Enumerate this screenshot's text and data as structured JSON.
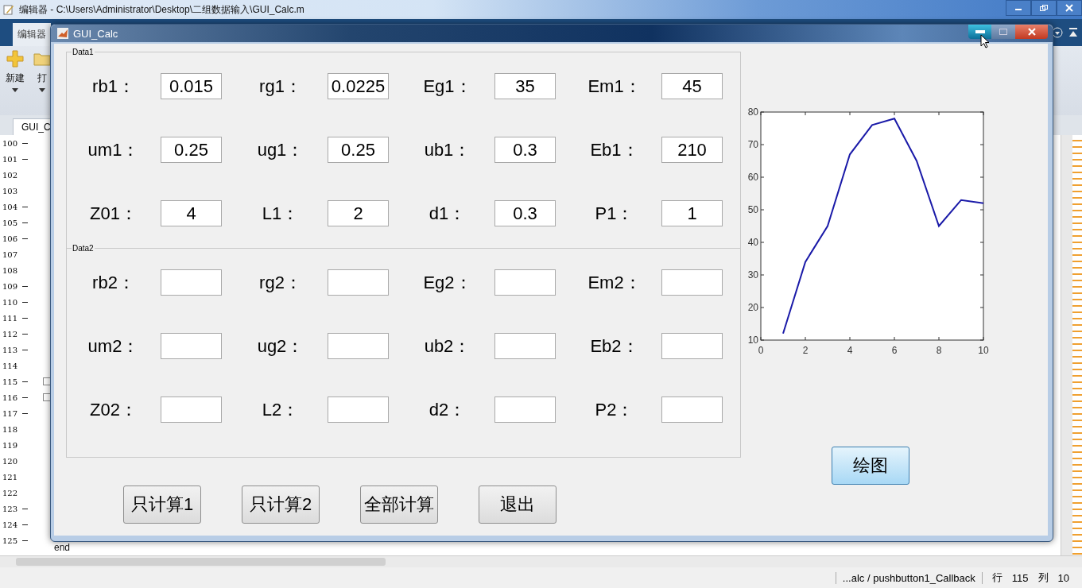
{
  "editor": {
    "title": "编辑器 - C:\\Users\\Administrator\\Desktop\\二组数据输入\\GUI_Calc.m",
    "ribbon_tab": "编辑器",
    "tools": [
      {
        "kind": "new",
        "label": "新建"
      },
      {
        "kind": "open",
        "label": "打"
      }
    ],
    "file_tab": "GUI_C",
    "lines": [
      {
        "number": "100",
        "marker": true,
        "fold": false
      },
      {
        "number": "101",
        "marker": true,
        "fold": false
      },
      {
        "number": "102",
        "marker": false,
        "fold": false
      },
      {
        "number": "103",
        "marker": false,
        "fold": false
      },
      {
        "number": "104",
        "marker": true,
        "fold": false
      },
      {
        "number": "105",
        "marker": true,
        "fold": false
      },
      {
        "number": "106",
        "marker": true,
        "fold": false
      },
      {
        "number": "107",
        "marker": false,
        "fold": false
      },
      {
        "number": "108",
        "marker": false,
        "fold": false
      },
      {
        "number": "109",
        "marker": true,
        "fold": false
      },
      {
        "number": "110",
        "marker": true,
        "fold": false
      },
      {
        "number": "111",
        "marker": true,
        "fold": false
      },
      {
        "number": "112",
        "marker": true,
        "fold": false
      },
      {
        "number": "113",
        "marker": true,
        "fold": false
      },
      {
        "number": "114",
        "marker": false,
        "fold": false
      },
      {
        "number": "115",
        "marker": true,
        "fold": true
      },
      {
        "number": "116",
        "marker": true,
        "fold": true
      },
      {
        "number": "117",
        "marker": true,
        "fold": false
      },
      {
        "number": "118",
        "marker": false,
        "fold": false
      },
      {
        "number": "119",
        "marker": false,
        "fold": false
      },
      {
        "number": "120",
        "marker": false,
        "fold": false
      },
      {
        "number": "121",
        "marker": false,
        "fold": false
      },
      {
        "number": "122",
        "marker": false,
        "fold": false
      },
      {
        "number": "123",
        "marker": true,
        "fold": false
      },
      {
        "number": "124",
        "marker": true,
        "fold": false
      },
      {
        "number": "125",
        "marker": true,
        "fold": false,
        "code": "end"
      }
    ],
    "status": {
      "location": "...alc / pushbutton1_Callback",
      "row_label": "行",
      "row": "115",
      "col_label": "列",
      "col": "10"
    }
  },
  "gui": {
    "title": "GUI_Calc",
    "panels": [
      {
        "title": "Data1",
        "fields": [
          {
            "label": "rb1：",
            "value": "0.015"
          },
          {
            "label": "rg1：",
            "value": "0.0225"
          },
          {
            "label": "Eg1：",
            "value": "35"
          },
          {
            "label": "Em1：",
            "value": "45"
          },
          {
            "label": "um1：",
            "value": "0.25"
          },
          {
            "label": "ug1：",
            "value": "0.25"
          },
          {
            "label": "ub1：",
            "value": "0.3"
          },
          {
            "label": "Eb1：",
            "value": "210"
          },
          {
            "label": "Z01：",
            "value": "4"
          },
          {
            "label": "L1：",
            "value": "2"
          },
          {
            "label": "d1：",
            "value": "0.3"
          },
          {
            "label": "P1：",
            "value": "1"
          }
        ]
      },
      {
        "title": "Data2",
        "fields": [
          {
            "label": "rb2："
          },
          {
            "label": "rg2："
          },
          {
            "label": "Eg2："
          },
          {
            "label": "Em2："
          },
          {
            "label": "um2："
          },
          {
            "label": "ug2："
          },
          {
            "label": "ub2："
          },
          {
            "label": "Eb2："
          },
          {
            "label": "Z02："
          },
          {
            "label": "L2："
          },
          {
            "label": "d2："
          },
          {
            "label": "P2："
          }
        ]
      }
    ],
    "chart_data": {
      "type": "line",
      "x": [
        1,
        2,
        3,
        4,
        5,
        6,
        7,
        8,
        9,
        10
      ],
      "series": [
        {
          "color": "#1a1aa8",
          "values": [
            12,
            34,
            45,
            67,
            76,
            78,
            65,
            45,
            53,
            52
          ]
        }
      ],
      "xlim": [
        0,
        10
      ],
      "ylim": [
        10,
        80
      ],
      "xticks": [
        0,
        2,
        4,
        6,
        8,
        10
      ],
      "yticks": [
        10,
        20,
        30,
        40,
        50,
        60,
        70,
        80
      ]
    },
    "plot_button": {
      "label": "绘图",
      "selected": true
    },
    "buttons": [
      "只计算1",
      "只计算2",
      "全部计算",
      "退出"
    ]
  }
}
